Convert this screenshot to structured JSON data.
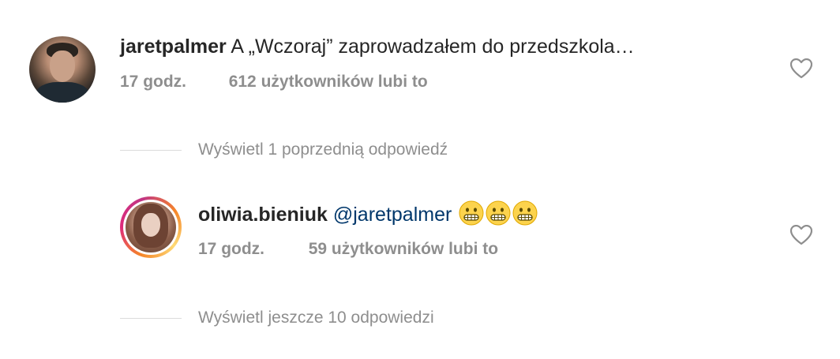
{
  "comment1": {
    "username": "jaretpalmer",
    "text": "A „Wczoraj” zaprowadzałem do przedszkola…",
    "time": "17 godz.",
    "likes": "612 użytkowników lubi to"
  },
  "thread1": {
    "view_previous": "Wyświetl 1 poprzednią odpowiedź"
  },
  "reply1": {
    "username": "oliwia.bieniuk",
    "mention": "@jaretpalmer",
    "emojis": [
      "grimacing-face-emoji",
      "grimacing-face-emoji",
      "grimacing-face-emoji"
    ],
    "time": "17 godz.",
    "likes": "59 użytkowników lubi to"
  },
  "thread2": {
    "view_more": "Wyświetl jeszcze 10 odpowiedzi"
  },
  "icons": {
    "like": "heart-outline-icon"
  },
  "colors": {
    "text": "#262626",
    "secondary": "#8e8e8e",
    "mention": "#00376b",
    "emoji": "#fcd34d"
  }
}
